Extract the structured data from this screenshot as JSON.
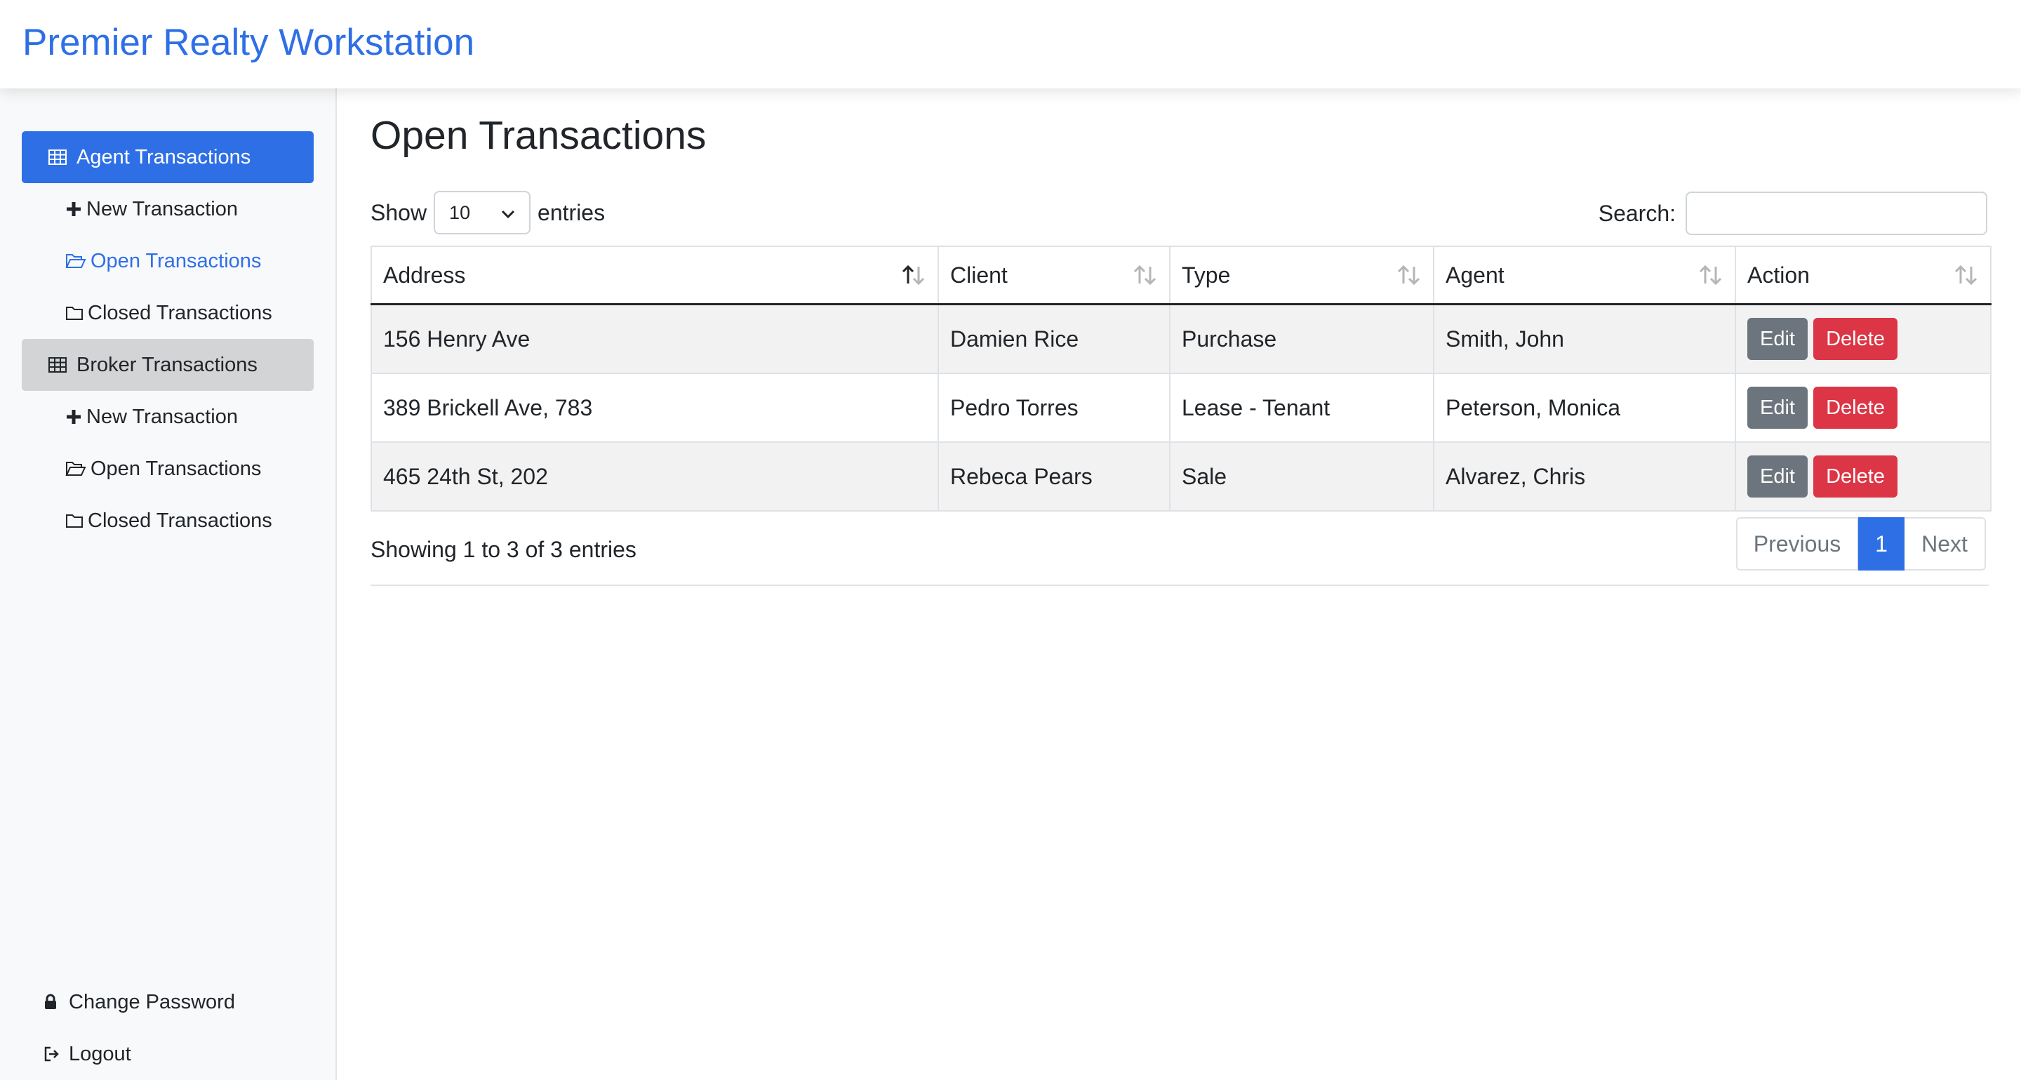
{
  "app": {
    "title": "Premier Realty Workstation"
  },
  "sidebar": {
    "sections": [
      {
        "label": "Agent Transactions",
        "items": [
          {
            "label": "New Transaction",
            "icon": "plus-icon"
          },
          {
            "label": "Open Transactions",
            "icon": "folder-open-icon"
          },
          {
            "label": "Closed Transactions",
            "icon": "folder-icon"
          }
        ]
      },
      {
        "label": "Broker Transactions",
        "items": [
          {
            "label": "New Transaction",
            "icon": "plus-icon"
          },
          {
            "label": "Open Transactions",
            "icon": "folder-open-icon"
          },
          {
            "label": "Closed Transactions",
            "icon": "folder-icon"
          }
        ]
      }
    ],
    "bottom": {
      "change_password": "Change Password",
      "logout": "Logout"
    }
  },
  "main": {
    "title": "Open Transactions",
    "length": {
      "prefix": "Show",
      "value": "10",
      "suffix": "entries"
    },
    "search": {
      "label": "Search:",
      "value": "",
      "placeholder": ""
    },
    "table": {
      "columns": [
        "Address",
        "Client",
        "Type",
        "Agent",
        "Action"
      ],
      "sorted_column": "Address",
      "sort_direction": "ascending",
      "rows": [
        {
          "address": "156 Henry Ave",
          "client": "Damien Rice",
          "type": "Purchase",
          "agent": "Smith, John"
        },
        {
          "address": "389 Brickell Ave, 783",
          "client": "Pedro Torres",
          "type": "Lease - Tenant",
          "agent": "Peterson, Monica"
        },
        {
          "address": "465 24th St, 202",
          "client": "Rebeca Pears",
          "type": "Sale",
          "agent": "Alvarez, Chris"
        }
      ],
      "action_labels": {
        "edit": "Edit",
        "delete": "Delete"
      }
    },
    "info": "Showing 1 to 3 of 3 entries",
    "pagination": {
      "previous": "Previous",
      "current": "1",
      "next": "Next"
    }
  },
  "colors": {
    "accent": "#2f6fe6",
    "edit": "#6c757d",
    "delete": "#dc3545",
    "sidebar_bg": "#f8f9fa",
    "active_grey": "#d3d4d5"
  }
}
